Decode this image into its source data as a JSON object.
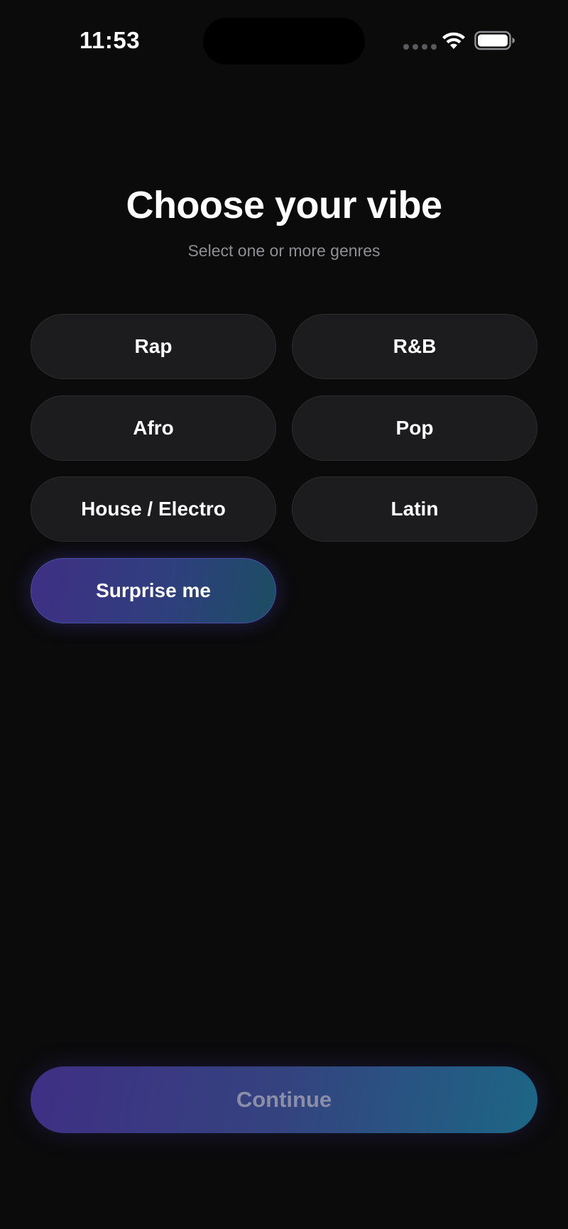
{
  "status_bar": {
    "time": "11:53",
    "icons": [
      "signal-dots-icon",
      "wifi-icon",
      "battery-icon"
    ]
  },
  "header": {
    "title": "Choose your vibe",
    "subtitle": "Select one or more genres"
  },
  "genres": [
    {
      "label": "Rap"
    },
    {
      "label": "R&B"
    },
    {
      "label": "Afro"
    },
    {
      "label": "Pop"
    },
    {
      "label": "House / Electro"
    },
    {
      "label": "Latin"
    },
    {
      "label": "Surprise me"
    }
  ],
  "continue": {
    "label": "Continue"
  },
  "colors": {
    "background": "#0b0b0c",
    "chip_background": "#1c1c1e",
    "accent_purple": "#3f2f84",
    "accent_teal": "#1c6685",
    "subtitle": "#8e8e93"
  }
}
